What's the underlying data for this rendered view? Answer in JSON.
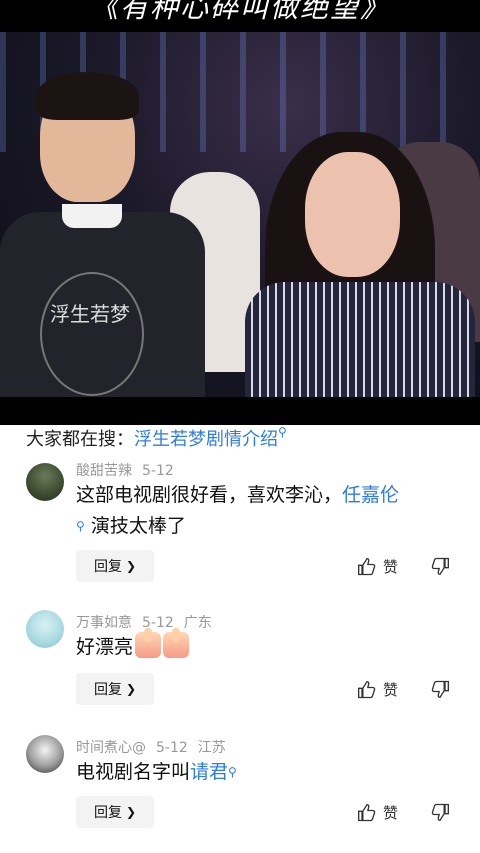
{
  "video": {
    "caption": "《有种心碎叫做绝望》",
    "shirt_print": "浮生若梦"
  },
  "search_bar": {
    "prefix": "大家都在搜：",
    "term": "浮生若梦剧情介绍"
  },
  "comments": [
    {
      "username": "酸甜苦辣",
      "date": "5-12",
      "location": "",
      "text_before": "这部电视剧很好看，喜欢李沁，",
      "link": "任嘉伦",
      "text_after": "演技太棒了",
      "reply_label": "回复",
      "like_label": "赞"
    },
    {
      "username": "万事如意",
      "date": "5-12",
      "location": "广东",
      "text": "好漂亮",
      "reply_label": "回复",
      "like_label": "赞"
    },
    {
      "username": "时间煮心@",
      "date": "5-12",
      "location": "江苏",
      "text_before": "电视剧名字叫",
      "link": "请君",
      "reply_label": "回复",
      "like_label": "赞"
    }
  ],
  "colors": {
    "link": "#2f7de1",
    "meta": "#999999",
    "reply_bg": "#f3f3f3"
  }
}
